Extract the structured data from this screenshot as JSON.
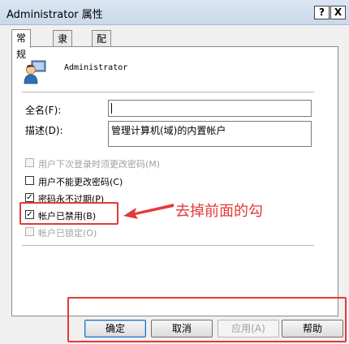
{
  "window": {
    "title": "Administrator 属性",
    "help_button": "?",
    "close_button": "X"
  },
  "tabs": [
    {
      "label": "常规",
      "active": true
    },
    {
      "label": "隶属于",
      "active": false
    },
    {
      "label": "配置文件",
      "active": false
    }
  ],
  "user": {
    "name": "Administrator",
    "icon": "user-account-icon"
  },
  "fields": {
    "fullname_label": "全名(F):",
    "fullname_value": "",
    "description_label": "描述(D):",
    "description_value": "管理计算机(域)的内置帐户"
  },
  "options": [
    {
      "label": "用户下次登录时须更改密码(M)",
      "checked": false,
      "enabled": false
    },
    {
      "label": "用户不能更改密码(C)",
      "checked": false,
      "enabled": true
    },
    {
      "label": "密码永不过期(P)",
      "checked": true,
      "enabled": true
    },
    {
      "label": "帐户已禁用(B)",
      "checked": true,
      "enabled": true
    },
    {
      "label": "帐户已锁定(O)",
      "checked": false,
      "enabled": false
    }
  ],
  "annotation": {
    "text": "去掉前面的勾",
    "color": "#e23a3a"
  },
  "buttons": {
    "ok": "确定",
    "cancel": "取消",
    "apply": "应用(A)",
    "help": "帮助"
  },
  "colors": {
    "titlebar": "#c9d8ea",
    "accent": "#2b6fb5",
    "annotation": "#e23a3a"
  }
}
